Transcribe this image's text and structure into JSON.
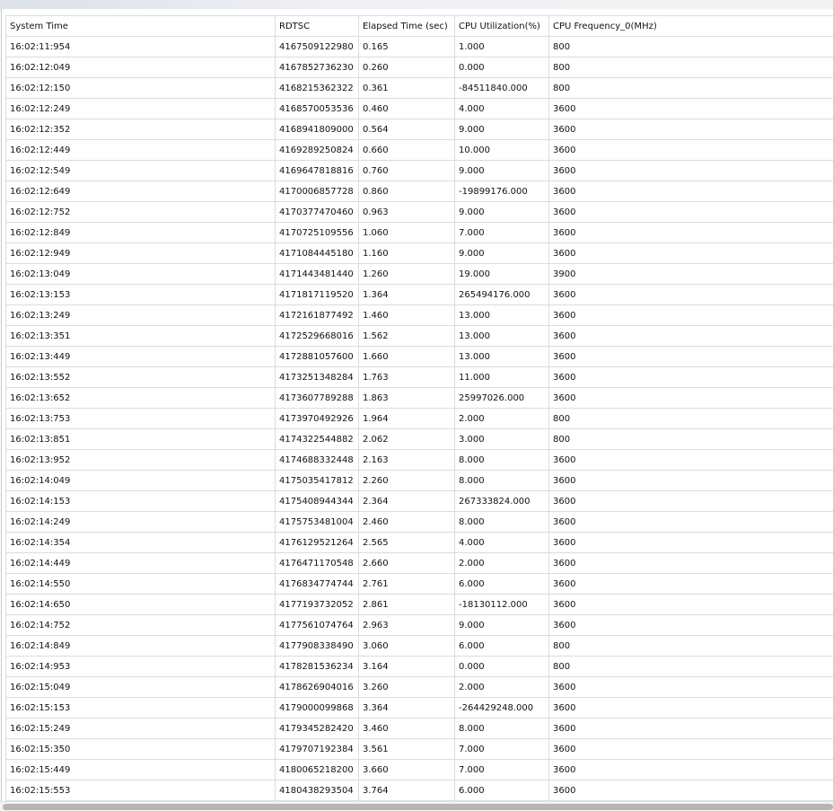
{
  "table": {
    "columns": [
      "System Time",
      "RDTSC",
      "Elapsed Time (sec)",
      "CPU Utilization(%)",
      "CPU Frequency_0(MHz)"
    ],
    "rows": [
      [
        "16:02:11:954",
        "4167509122980",
        "0.165",
        "1.000",
        "800"
      ],
      [
        "16:02:12:049",
        "4167852736230",
        "0.260",
        "0.000",
        "800"
      ],
      [
        "16:02:12:150",
        "4168215362322",
        "0.361",
        "-84511840.000",
        "800"
      ],
      [
        "16:02:12:249",
        "4168570053536",
        "0.460",
        "4.000",
        "3600"
      ],
      [
        "16:02:12:352",
        "4168941809000",
        "0.564",
        "9.000",
        "3600"
      ],
      [
        "16:02:12:449",
        "4169289250824",
        "0.660",
        "10.000",
        "3600"
      ],
      [
        "16:02:12:549",
        "4169647818816",
        "0.760",
        "9.000",
        "3600"
      ],
      [
        "16:02:12:649",
        "4170006857728",
        "0.860",
        "-19899176.000",
        "3600"
      ],
      [
        "16:02:12:752",
        "4170377470460",
        "0.963",
        "9.000",
        "3600"
      ],
      [
        "16:02:12:849",
        "4170725109556",
        "1.060",
        "7.000",
        "3600"
      ],
      [
        "16:02:12:949",
        "4171084445180",
        "1.160",
        "9.000",
        "3600"
      ],
      [
        "16:02:13:049",
        "4171443481440",
        "1.260",
        "19.000",
        "3900"
      ],
      [
        "16:02:13:153",
        "4171817119520",
        "1.364",
        "265494176.000",
        "3600"
      ],
      [
        "16:02:13:249",
        "4172161877492",
        "1.460",
        "13.000",
        "3600"
      ],
      [
        "16:02:13:351",
        "4172529668016",
        "1.562",
        "13.000",
        "3600"
      ],
      [
        "16:02:13:449",
        "4172881057600",
        "1.660",
        "13.000",
        "3600"
      ],
      [
        "16:02:13:552",
        "4173251348284",
        "1.763",
        "11.000",
        "3600"
      ],
      [
        "16:02:13:652",
        "4173607789288",
        "1.863",
        "25997026.000",
        "3600"
      ],
      [
        "16:02:13:753",
        "4173970492926",
        "1.964",
        "2.000",
        "800"
      ],
      [
        "16:02:13:851",
        "4174322544882",
        "2.062",
        "3.000",
        "800"
      ],
      [
        "16:02:13:952",
        "4174688332448",
        "2.163",
        "8.000",
        "3600"
      ],
      [
        "16:02:14:049",
        "4175035417812",
        "2.260",
        "8.000",
        "3600"
      ],
      [
        "16:02:14:153",
        "4175408944344",
        "2.364",
        "267333824.000",
        "3600"
      ],
      [
        "16:02:14:249",
        "4175753481004",
        "2.460",
        "8.000",
        "3600"
      ],
      [
        "16:02:14:354",
        "4176129521264",
        "2.565",
        "4.000",
        "3600"
      ],
      [
        "16:02:14:449",
        "4176471170548",
        "2.660",
        "2.000",
        "3600"
      ],
      [
        "16:02:14:550",
        "4176834774744",
        "2.761",
        "6.000",
        "3600"
      ],
      [
        "16:02:14:650",
        "4177193732052",
        "2.861",
        "-18130112.000",
        "3600"
      ],
      [
        "16:02:14:752",
        "4177561074764",
        "2.963",
        "9.000",
        "3600"
      ],
      [
        "16:02:14:849",
        "4177908338490",
        "3.060",
        "6.000",
        "800"
      ],
      [
        "16:02:14:953",
        "4178281536234",
        "3.164",
        "0.000",
        "800"
      ],
      [
        "16:02:15:049",
        "4178626904016",
        "3.260",
        "2.000",
        "3600"
      ],
      [
        "16:02:15:153",
        "4179000099868",
        "3.364",
        "-264429248.000",
        "3600"
      ],
      [
        "16:02:15:249",
        "4179345282420",
        "3.460",
        "8.000",
        "3600"
      ],
      [
        "16:02:15:350",
        "4179707192384",
        "3.561",
        "7.000",
        "3600"
      ],
      [
        "16:02:15:449",
        "4180065218200",
        "3.660",
        "7.000",
        "3600"
      ],
      [
        "16:02:15:553",
        "4180438293504",
        "3.764",
        "6.000",
        "3600"
      ]
    ]
  }
}
